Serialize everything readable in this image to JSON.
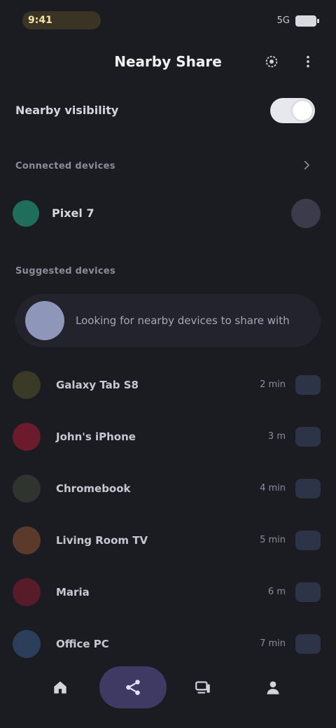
{
  "status_bar": {
    "time": "9:41",
    "right_text": "5G",
    "battery_icon": "battery-icon"
  },
  "header": {
    "title": "Nearby Share",
    "actions": [
      {
        "icon": "settings-icon"
      },
      {
        "icon": "more-vert-icon"
      }
    ]
  },
  "visibility": {
    "label": "Nearby visibility",
    "toggle_on": true
  },
  "connected": {
    "section_title": "Connected devices",
    "items": [
      {
        "name": "Pixel 7",
        "color": "#1f6d5b"
      }
    ]
  },
  "suggestions": {
    "section_title": "Suggested devices",
    "search_text": "Looking for nearby devices to share with"
  },
  "devices": [
    {
      "name": "Galaxy Tab S8",
      "meta": "2 min",
      "color": "#3b3a27"
    },
    {
      "name": "John's iPhone",
      "meta": "3 m",
      "color": "#6b1b2b"
    },
    {
      "name": "Chromebook",
      "meta": "4 min",
      "color": "#2f342f"
    },
    {
      "name": "Living Room TV",
      "meta": "5 min",
      "color": "#5b3a2b"
    },
    {
      "name": "Maria",
      "meta": "6 m",
      "color": "#581b28"
    },
    {
      "name": "Office PC",
      "meta": "7 min",
      "color": "#2b3f5a"
    }
  ],
  "bottom_nav": {
    "items": [
      {
        "icon": "home-icon"
      },
      {
        "icon": "share-icon",
        "active": true
      },
      {
        "icon": "devices-icon"
      },
      {
        "icon": "profile-icon"
      }
    ]
  },
  "colors": {
    "background": "#1b1b22",
    "accent": "#3e3a63",
    "toggle": "#e7e7ee"
  }
}
